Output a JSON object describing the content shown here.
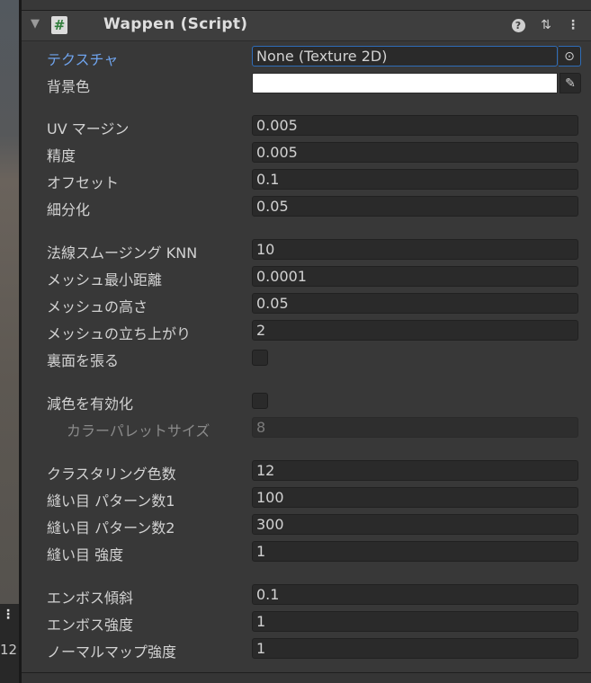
{
  "scene": {
    "menu_glyph": "⋮",
    "number": "12"
  },
  "header": {
    "fold_glyph": "▼",
    "script_icon_glyph": "#",
    "title": "Wappen (Script)",
    "help_glyph": "?",
    "presets_glyph": "⇅",
    "more_glyph": "⋮"
  },
  "fields": {
    "texture": {
      "label": "テクスチャ",
      "value": "None (Texture 2D)",
      "picker_glyph": "⊙"
    },
    "background_color": {
      "label": "背景色",
      "color": "#ffffff",
      "eyedropper_glyph": "✎"
    },
    "uv_margin": {
      "label": "UV マージン",
      "value": "0.005"
    },
    "precision": {
      "label": "精度",
      "value": "0.005"
    },
    "offset": {
      "label": "オフセット",
      "value": "0.1"
    },
    "subdivision": {
      "label": "細分化",
      "value": "0.05"
    },
    "normal_smoothing_knn": {
      "label": "法線スムージング KNN",
      "value": "10"
    },
    "mesh_min_distance": {
      "label": "メッシュ最小距離",
      "value": "0.0001"
    },
    "mesh_height": {
      "label": "メッシュの高さ",
      "value": "0.05"
    },
    "mesh_rise": {
      "label": "メッシュの立ち上がり",
      "value": "2"
    },
    "back_face": {
      "label": "裏面を張る",
      "checked": false
    },
    "color_reduction": {
      "label": "減色を有効化",
      "checked": false
    },
    "palette_size": {
      "label": "カラーパレットサイズ",
      "value": "8"
    },
    "clustering_colors": {
      "label": "クラスタリング色数",
      "value": "12"
    },
    "stitch_pattern1": {
      "label": "縫い目 パターン数1",
      "value": "100"
    },
    "stitch_pattern2": {
      "label": "縫い目 パターン数2",
      "value": "300"
    },
    "stitch_strength": {
      "label": "縫い目 強度",
      "value": "1"
    },
    "emboss_slope": {
      "label": "エンボス傾斜",
      "value": "0.1"
    },
    "emboss_strength": {
      "label": "エンボス強度",
      "value": "1"
    },
    "normal_map_strength": {
      "label": "ノーマルマップ強度",
      "value": "1"
    }
  },
  "colors": {
    "link_label": "#6fa3ec",
    "panel_bg": "#383838",
    "field_bg": "#2a2a2a",
    "focus_border": "#2f6db8"
  }
}
